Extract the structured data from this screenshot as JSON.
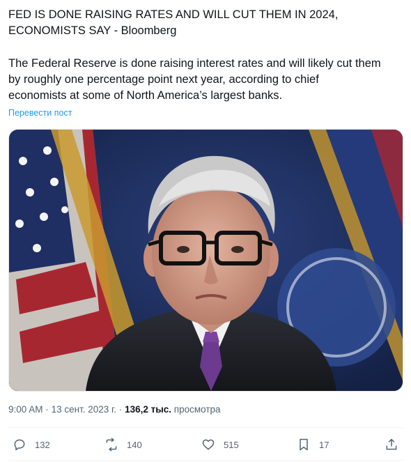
{
  "post": {
    "headline_line1": "FED IS DONE RAISING RATES AND WILL CUT THEM IN 2024,",
    "headline_line2": "ECONOMISTS SAY - Bloomberg",
    "body_line1": "The Federal Reserve is done raising interest rates and will likely cut them",
    "body_line2": "by roughly one percentage point next year, according to chief",
    "body_line3": "economists at some of North America’s largest banks.",
    "translate_label": "Перевести пост"
  },
  "meta": {
    "time": "9:00 AM",
    "separator": "·",
    "date": "13 сент. 2023 г.",
    "views_count": "136,2 тыс.",
    "views_label": "просмотра"
  },
  "actions": {
    "replies": "132",
    "reposts": "140",
    "likes": "515",
    "bookmarks": "17"
  },
  "icons": {
    "reply": "reply-icon",
    "repost": "repost-icon",
    "like": "heart-icon",
    "bookmark": "bookmark-icon",
    "share": "share-icon"
  },
  "colors": {
    "link": "#1d9bf0",
    "muted": "#536471",
    "text": "#0f1419"
  }
}
